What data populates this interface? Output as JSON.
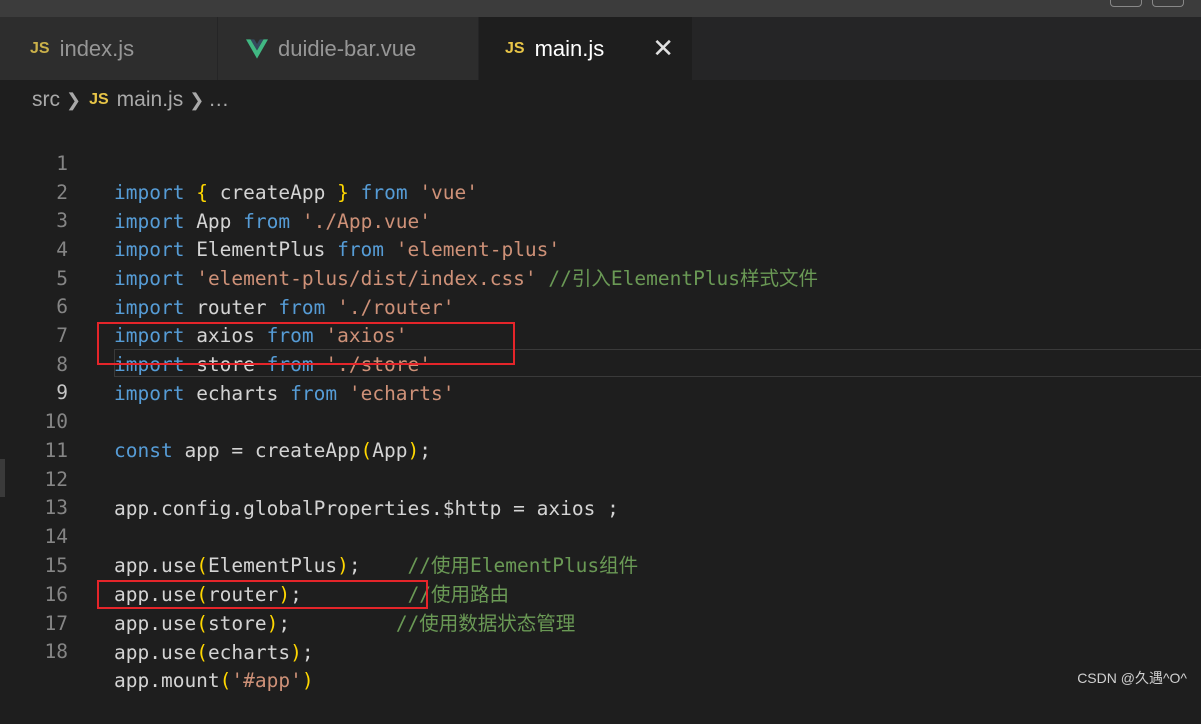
{
  "tabs": [
    {
      "label": "index.js",
      "icon": "javascript-icon",
      "icon_text": "JS",
      "active": false
    },
    {
      "label": "duidie-bar.vue",
      "icon": "vue-icon",
      "active": false
    },
    {
      "label": "main.js",
      "icon": "javascript-icon",
      "icon_text": "JS",
      "active": true,
      "close": "✕"
    }
  ],
  "breadcrumb": {
    "folder": "src",
    "icon_text": "JS",
    "file": "main.js",
    "more": "…"
  },
  "lines": [
    {
      "n": "1"
    },
    {
      "n": "2"
    },
    {
      "n": "3"
    },
    {
      "n": "4"
    },
    {
      "n": "5"
    },
    {
      "n": "6"
    },
    {
      "n": "7"
    },
    {
      "n": "8"
    },
    {
      "n": "9"
    },
    {
      "n": "10"
    },
    {
      "n": "11"
    },
    {
      "n": "12"
    },
    {
      "n": "13"
    },
    {
      "n": "14"
    },
    {
      "n": "15"
    },
    {
      "n": "16"
    },
    {
      "n": "17"
    },
    {
      "n": "18"
    }
  ],
  "code": {
    "l1": [
      "import",
      "{",
      " createApp ",
      "}",
      "from",
      "'vue'"
    ],
    "l2": [
      "import",
      " App ",
      "from",
      "'./App.vue'"
    ],
    "l3": [
      "import",
      " ElementPlus ",
      "from",
      "'element-plus'"
    ],
    "l4": [
      "import",
      "'element-plus/dist/index.css'",
      "//引入ElementPlus样式文件"
    ],
    "l5": [
      "import",
      " router ",
      "from",
      "'./router'"
    ],
    "l6": [
      "import",
      " axios ",
      "from",
      "'axios'"
    ],
    "l7": [
      "import",
      " store ",
      "from",
      "'./store'"
    ],
    "l8": [
      "import",
      " echarts ",
      "from",
      "'echarts'"
    ],
    "l10": [
      "const",
      " app = createApp",
      "(",
      "App",
      ")",
      ";"
    ],
    "l12": [
      "app.config.globalProperties.$http = axios ;"
    ],
    "l14": [
      "app.use",
      "(",
      "ElementPlus",
      ")",
      ";",
      "//使用ElementPlus组件"
    ],
    "l15": [
      "app.use",
      "(",
      "router",
      ")",
      ";",
      "//使用路由"
    ],
    "l16": [
      "app.use",
      "(",
      "store",
      ")",
      ";",
      "//使用数据状态管理"
    ],
    "l17": [
      "app.use",
      "(",
      "echarts",
      ")",
      ";"
    ],
    "l18": [
      "app.mount",
      "(",
      "'#app'",
      ")"
    ]
  },
  "watermark": "CSDN @久遇^O^",
  "colors": {
    "keyword": "#569cd6",
    "string": "#ce9178",
    "comment": "#6a9955",
    "bracket": "#ffd700",
    "highlight_box": "#e5252a"
  }
}
